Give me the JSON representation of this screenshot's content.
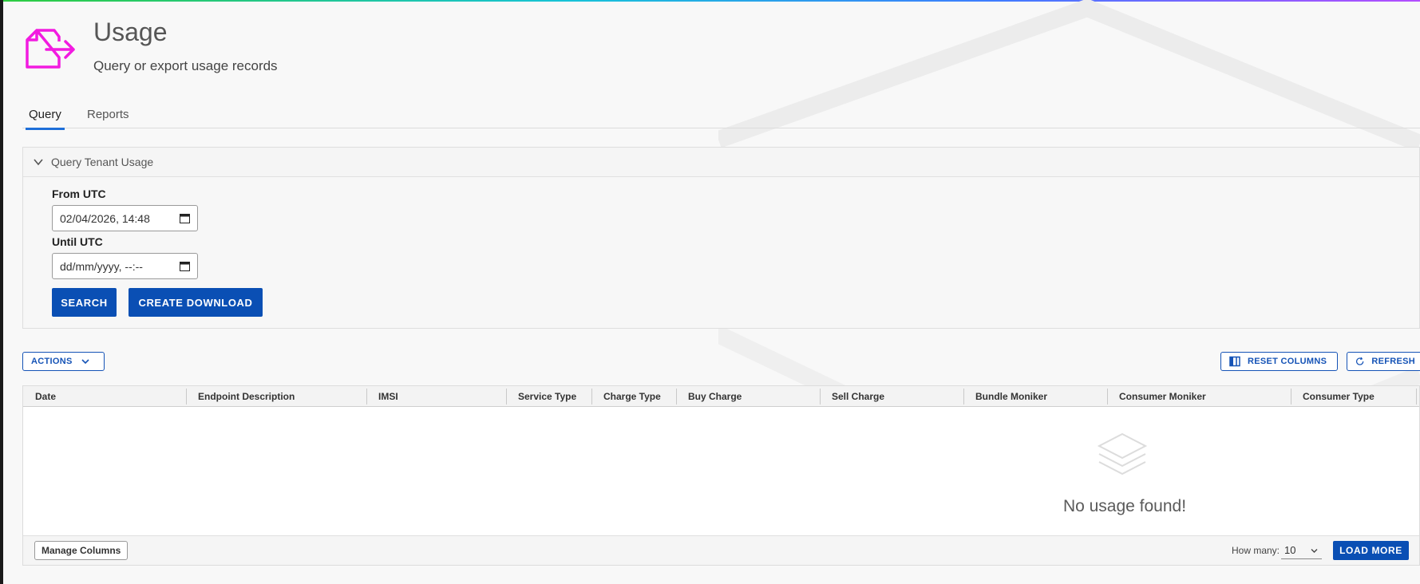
{
  "header": {
    "title": "Usage",
    "subtitle": "Query or export usage records",
    "icon": "export-file-icon",
    "icon_color": "#f21be0"
  },
  "tabs": [
    {
      "label": "Query",
      "active": true
    },
    {
      "label": "Reports",
      "active": false
    }
  ],
  "query_panel": {
    "title": "Query Tenant Usage",
    "expanded": true,
    "from_label": "From UTC",
    "from_value": "02/04/2026, 14:48",
    "until_label": "Until UTC",
    "until_value": "dd/mm/yyyy, --:--",
    "search_label": "SEARCH",
    "download_label": "CREATE DOWNLOAD"
  },
  "toolbar": {
    "actions_label": "ACTIONS",
    "reset_columns_label": "RESET COLUMNS",
    "refresh_label": "REFRESH"
  },
  "grid": {
    "columns": [
      "Date",
      "Endpoint Description",
      "IMSI",
      "Service Type",
      "Charge Type",
      "Buy Charge",
      "Sell Charge",
      "Bundle Moniker",
      "Consumer Moniker",
      "Consumer Type"
    ],
    "empty_message": "No usage found!",
    "manage_columns_label": "Manage Columns",
    "how_many_label": "How many:",
    "how_many_value": "10",
    "load_more_label": "LOAD MORE"
  },
  "colors": {
    "primary": "#0a4fb4",
    "tab_underline": "#1e6fd9",
    "accent_icon": "#f21be0"
  }
}
